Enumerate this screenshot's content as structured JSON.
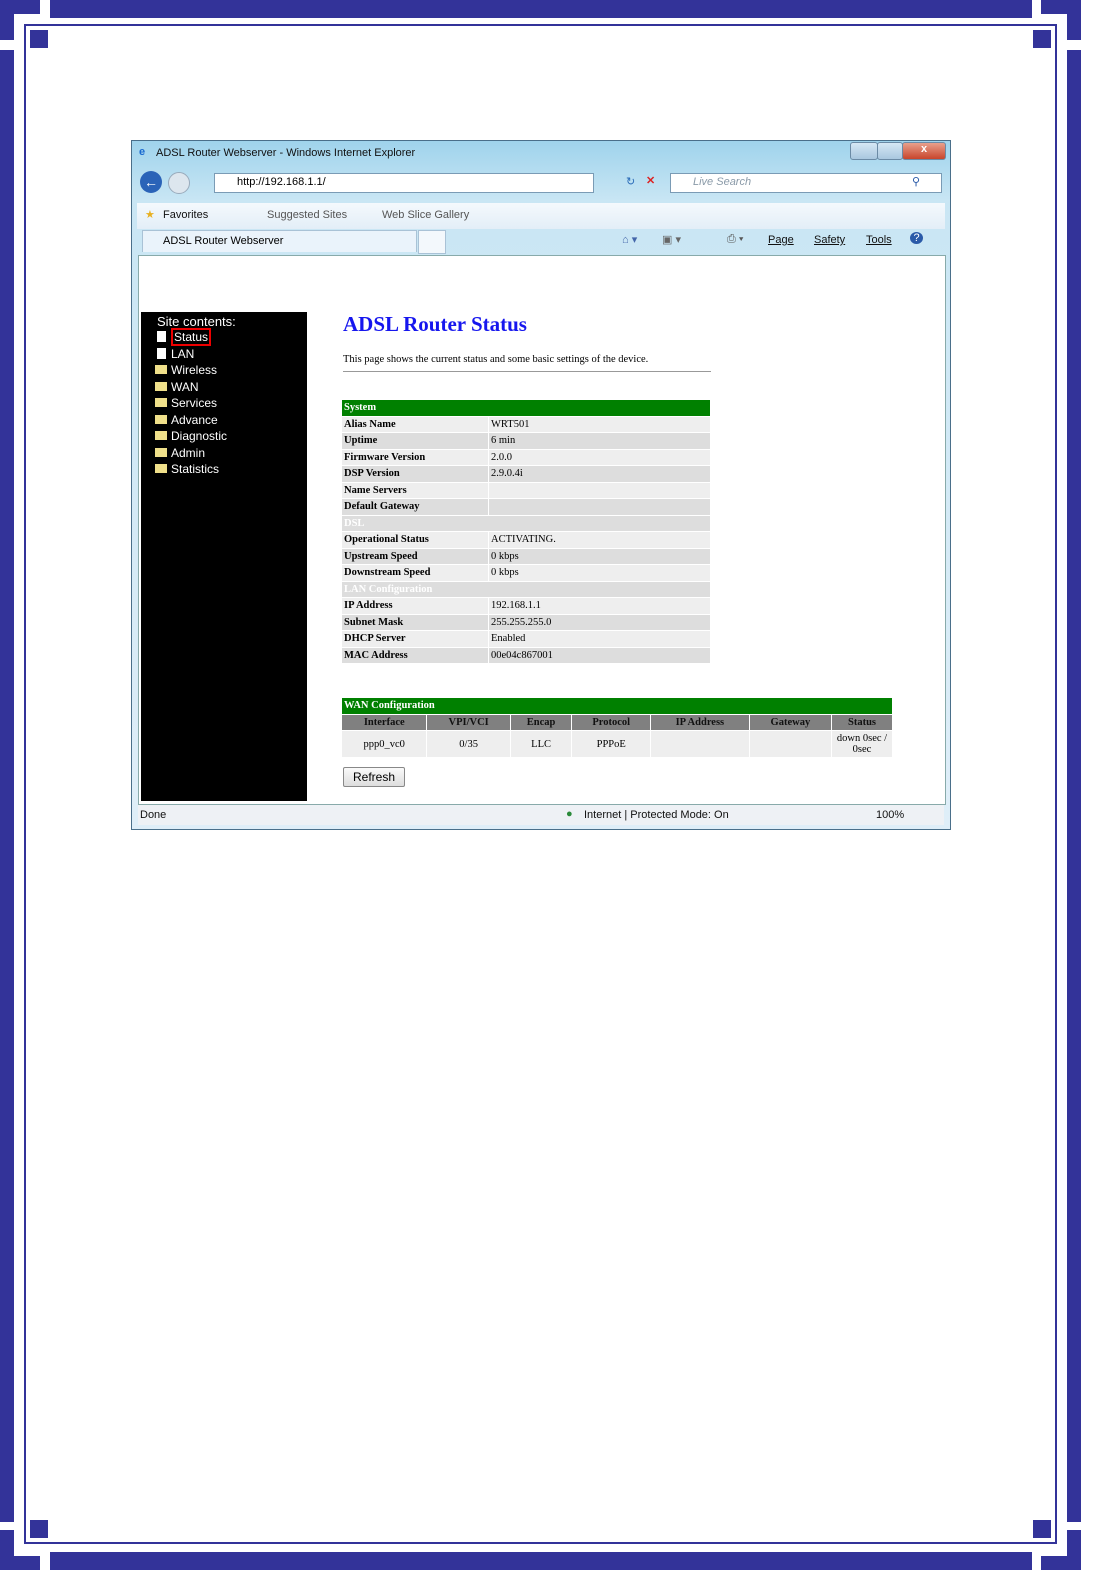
{
  "browser": {
    "title": "ADSL Router Webserver - Windows Internet Explorer",
    "address": "http://192.168.1.1/",
    "search_placeholder": "Live Search",
    "favorites": "Favorites",
    "suggested_sites": "Suggested Sites",
    "web_slice_gallery": "Web Slice Gallery",
    "tab_title": "ADSL Router Webserver",
    "commands": [
      "Page",
      "Safety",
      "Tools"
    ],
    "status_left": "Done",
    "status_zone": "Internet | Protected Mode: On",
    "zoom": "100%"
  },
  "sidebar": {
    "heading": "Site contents:",
    "items": [
      "Status",
      "LAN",
      "Wireless",
      "WAN",
      "Services",
      "Advance",
      "Diagnostic",
      "Admin",
      "Statistics"
    ],
    "selected": "Status"
  },
  "main": {
    "title": "ADSL Router Status",
    "description": "This page shows the current status and some basic settings of the device.",
    "sections": [
      {
        "title": "System",
        "rows": [
          [
            "Alias Name",
            "WRT501"
          ],
          [
            "Uptime",
            "6 min"
          ],
          [
            "Firmware Version",
            "2.0.0"
          ],
          [
            "DSP Version",
            "2.9.0.4i"
          ],
          [
            "Name Servers",
            ""
          ],
          [
            "Default Gateway",
            ""
          ]
        ]
      },
      {
        "title": "DSL",
        "rows": [
          [
            "Operational Status",
            "ACTIVATING."
          ],
          [
            "Upstream Speed",
            "0 kbps"
          ],
          [
            "Downstream Speed",
            "0 kbps"
          ]
        ]
      },
      {
        "title": "LAN Configuration",
        "rows": [
          [
            "IP Address",
            "192.168.1.1"
          ],
          [
            "Subnet Mask",
            "255.255.255.0"
          ],
          [
            "DHCP Server",
            "Enabled"
          ],
          [
            "MAC Address",
            "00e04c867001"
          ]
        ]
      }
    ],
    "wan": {
      "title": "WAN Configuration",
      "headers": [
        "Interface",
        "VPI/VCI",
        "Encap",
        "Protocol",
        "IP Address",
        "Gateway",
        "Status"
      ],
      "rows": [
        [
          "ppp0_vc0",
          "0/35",
          "LLC",
          "PPPoE",
          "",
          "",
          "down 0sec / 0sec"
        ]
      ]
    },
    "refresh_label": "Refresh"
  },
  "colors": {
    "frame": "#333399",
    "section_header": "#008000",
    "title": "#1616ee"
  }
}
